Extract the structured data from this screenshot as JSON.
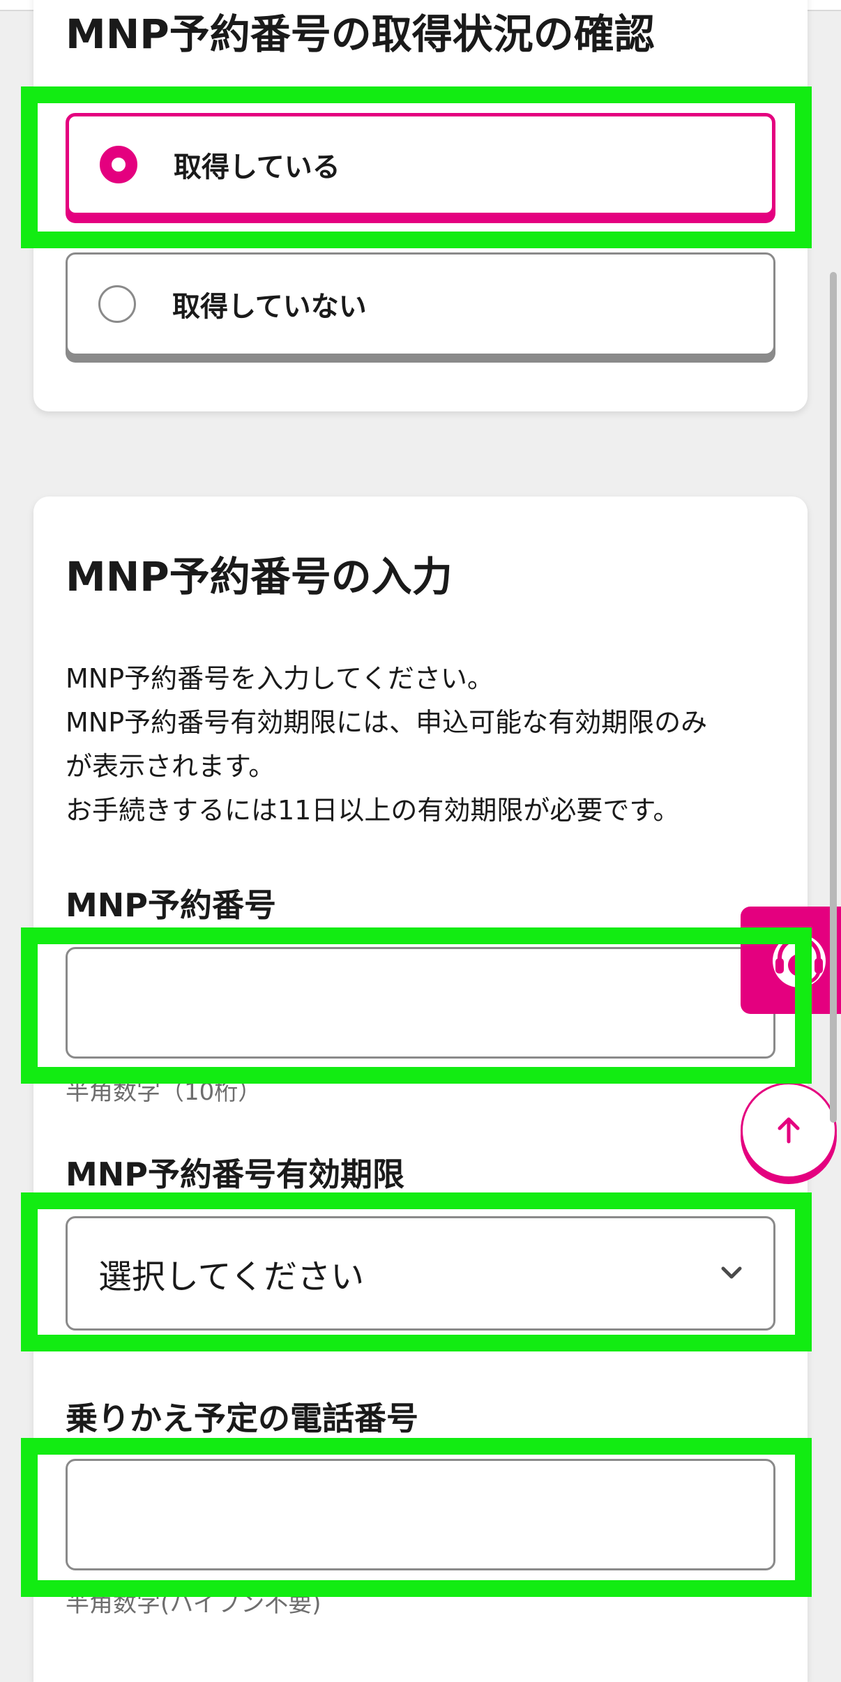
{
  "section_status": {
    "title": "MNP予約番号の取得状況の確認",
    "options": [
      {
        "label": "取得している",
        "selected": true
      },
      {
        "label": "取得していない",
        "selected": false
      }
    ]
  },
  "section_input": {
    "title": "MNP予約番号の入力",
    "description": [
      "MNP予約番号を入力してください。",
      "MNP予約番号有効期限には、申込可能な有効期限のみ",
      "が表示されます。",
      "お手続きするには11日以上の有効期限が必要です。"
    ],
    "mnp_number": {
      "label": "MNP予約番号",
      "value": "",
      "hint": "半角数字（10桁）"
    },
    "expiry": {
      "label": "MNP予約番号有効期限",
      "selected_value": "選択してください"
    },
    "phone": {
      "label": "乗りかえ予定の電話番号",
      "value": "",
      "hint": "半角数字(ハイフン不要)"
    }
  },
  "floating": {
    "support_icon": "headset-operator-icon",
    "scroll_top_icon": "arrow-up-icon"
  },
  "colors": {
    "accent": "#e4007f",
    "highlight": "#12ec12",
    "border": "#8a8a8a",
    "background": "#efefef"
  }
}
